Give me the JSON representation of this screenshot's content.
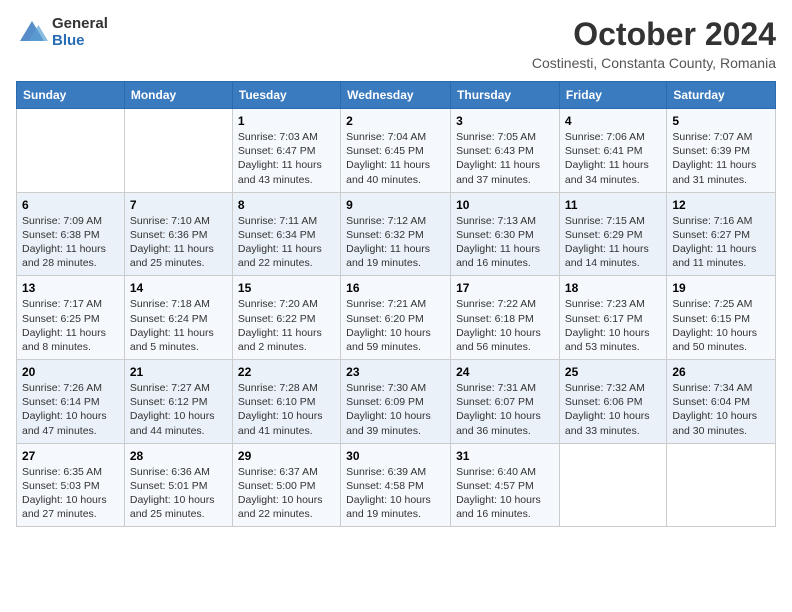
{
  "header": {
    "logo_general": "General",
    "logo_blue": "Blue",
    "month_title": "October 2024",
    "location": "Costinesti, Constanta County, Romania"
  },
  "weekdays": [
    "Sunday",
    "Monday",
    "Tuesday",
    "Wednesday",
    "Thursday",
    "Friday",
    "Saturday"
  ],
  "weeks": [
    [
      {
        "day": "",
        "info": ""
      },
      {
        "day": "",
        "info": ""
      },
      {
        "day": "1",
        "info": "Sunrise: 7:03 AM\nSunset: 6:47 PM\nDaylight: 11 hours and 43 minutes."
      },
      {
        "day": "2",
        "info": "Sunrise: 7:04 AM\nSunset: 6:45 PM\nDaylight: 11 hours and 40 minutes."
      },
      {
        "day": "3",
        "info": "Sunrise: 7:05 AM\nSunset: 6:43 PM\nDaylight: 11 hours and 37 minutes."
      },
      {
        "day": "4",
        "info": "Sunrise: 7:06 AM\nSunset: 6:41 PM\nDaylight: 11 hours and 34 minutes."
      },
      {
        "day": "5",
        "info": "Sunrise: 7:07 AM\nSunset: 6:39 PM\nDaylight: 11 hours and 31 minutes."
      }
    ],
    [
      {
        "day": "6",
        "info": "Sunrise: 7:09 AM\nSunset: 6:38 PM\nDaylight: 11 hours and 28 minutes."
      },
      {
        "day": "7",
        "info": "Sunrise: 7:10 AM\nSunset: 6:36 PM\nDaylight: 11 hours and 25 minutes."
      },
      {
        "day": "8",
        "info": "Sunrise: 7:11 AM\nSunset: 6:34 PM\nDaylight: 11 hours and 22 minutes."
      },
      {
        "day": "9",
        "info": "Sunrise: 7:12 AM\nSunset: 6:32 PM\nDaylight: 11 hours and 19 minutes."
      },
      {
        "day": "10",
        "info": "Sunrise: 7:13 AM\nSunset: 6:30 PM\nDaylight: 11 hours and 16 minutes."
      },
      {
        "day": "11",
        "info": "Sunrise: 7:15 AM\nSunset: 6:29 PM\nDaylight: 11 hours and 14 minutes."
      },
      {
        "day": "12",
        "info": "Sunrise: 7:16 AM\nSunset: 6:27 PM\nDaylight: 11 hours and 11 minutes."
      }
    ],
    [
      {
        "day": "13",
        "info": "Sunrise: 7:17 AM\nSunset: 6:25 PM\nDaylight: 11 hours and 8 minutes."
      },
      {
        "day": "14",
        "info": "Sunrise: 7:18 AM\nSunset: 6:24 PM\nDaylight: 11 hours and 5 minutes."
      },
      {
        "day": "15",
        "info": "Sunrise: 7:20 AM\nSunset: 6:22 PM\nDaylight: 11 hours and 2 minutes."
      },
      {
        "day": "16",
        "info": "Sunrise: 7:21 AM\nSunset: 6:20 PM\nDaylight: 10 hours and 59 minutes."
      },
      {
        "day": "17",
        "info": "Sunrise: 7:22 AM\nSunset: 6:18 PM\nDaylight: 10 hours and 56 minutes."
      },
      {
        "day": "18",
        "info": "Sunrise: 7:23 AM\nSunset: 6:17 PM\nDaylight: 10 hours and 53 minutes."
      },
      {
        "day": "19",
        "info": "Sunrise: 7:25 AM\nSunset: 6:15 PM\nDaylight: 10 hours and 50 minutes."
      }
    ],
    [
      {
        "day": "20",
        "info": "Sunrise: 7:26 AM\nSunset: 6:14 PM\nDaylight: 10 hours and 47 minutes."
      },
      {
        "day": "21",
        "info": "Sunrise: 7:27 AM\nSunset: 6:12 PM\nDaylight: 10 hours and 44 minutes."
      },
      {
        "day": "22",
        "info": "Sunrise: 7:28 AM\nSunset: 6:10 PM\nDaylight: 10 hours and 41 minutes."
      },
      {
        "day": "23",
        "info": "Sunrise: 7:30 AM\nSunset: 6:09 PM\nDaylight: 10 hours and 39 minutes."
      },
      {
        "day": "24",
        "info": "Sunrise: 7:31 AM\nSunset: 6:07 PM\nDaylight: 10 hours and 36 minutes."
      },
      {
        "day": "25",
        "info": "Sunrise: 7:32 AM\nSunset: 6:06 PM\nDaylight: 10 hours and 33 minutes."
      },
      {
        "day": "26",
        "info": "Sunrise: 7:34 AM\nSunset: 6:04 PM\nDaylight: 10 hours and 30 minutes."
      }
    ],
    [
      {
        "day": "27",
        "info": "Sunrise: 6:35 AM\nSunset: 5:03 PM\nDaylight: 10 hours and 27 minutes."
      },
      {
        "day": "28",
        "info": "Sunrise: 6:36 AM\nSunset: 5:01 PM\nDaylight: 10 hours and 25 minutes."
      },
      {
        "day": "29",
        "info": "Sunrise: 6:37 AM\nSunset: 5:00 PM\nDaylight: 10 hours and 22 minutes."
      },
      {
        "day": "30",
        "info": "Sunrise: 6:39 AM\nSunset: 4:58 PM\nDaylight: 10 hours and 19 minutes."
      },
      {
        "day": "31",
        "info": "Sunrise: 6:40 AM\nSunset: 4:57 PM\nDaylight: 10 hours and 16 minutes."
      },
      {
        "day": "",
        "info": ""
      },
      {
        "day": "",
        "info": ""
      }
    ]
  ]
}
